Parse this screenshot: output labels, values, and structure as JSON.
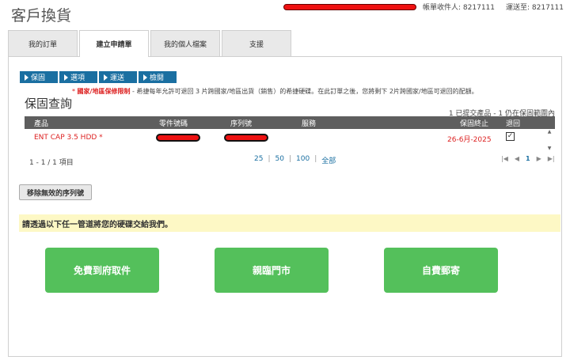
{
  "header": {
    "title": "客戶換貨",
    "account_holder_label": "帳單收件人: 8217111",
    "ship_to_label": "運送至: 8217111"
  },
  "tabs": [
    {
      "label": "我的訂單"
    },
    {
      "label": "建立申請單"
    },
    {
      "label": "我的個人檔案"
    },
    {
      "label": "支援"
    }
  ],
  "steps": [
    "保固",
    "選項",
    "運送",
    "檢閱"
  ],
  "notice": {
    "star": "*",
    "limit": "國家/地區保修限制",
    "text": " - 希捷每年允許可退回 3 片跨國家/地區出貨（銷售）的希捷硬碟。在此訂單之後，您將剩下 2片跨國家/地區可退回的配額。"
  },
  "section": {
    "title": "保固查詢",
    "summary": "1 已提交產品 - 1 仍在保固範圍內"
  },
  "table": {
    "headers": {
      "product": "產品",
      "part": "零件號碼",
      "serial": "序列號",
      "service": "服務",
      "end": "保固終止",
      "return": "退回"
    },
    "rows": [
      {
        "product": "ENT CAP 3.5 HDD *",
        "end": "26-6月-2025",
        "checked": "✓"
      }
    ]
  },
  "pager": {
    "count": "1 - 1 / 1 項目",
    "sizes": [
      "25",
      "50",
      "100",
      "全部"
    ],
    "page": "1"
  },
  "remove_button": "移除無效的序列號",
  "delivery_prompt": "請透過以下任一管道將您的硬碟交給我們。",
  "options": [
    "免費到府取件",
    "親臨門市",
    "自費郵寄"
  ]
}
